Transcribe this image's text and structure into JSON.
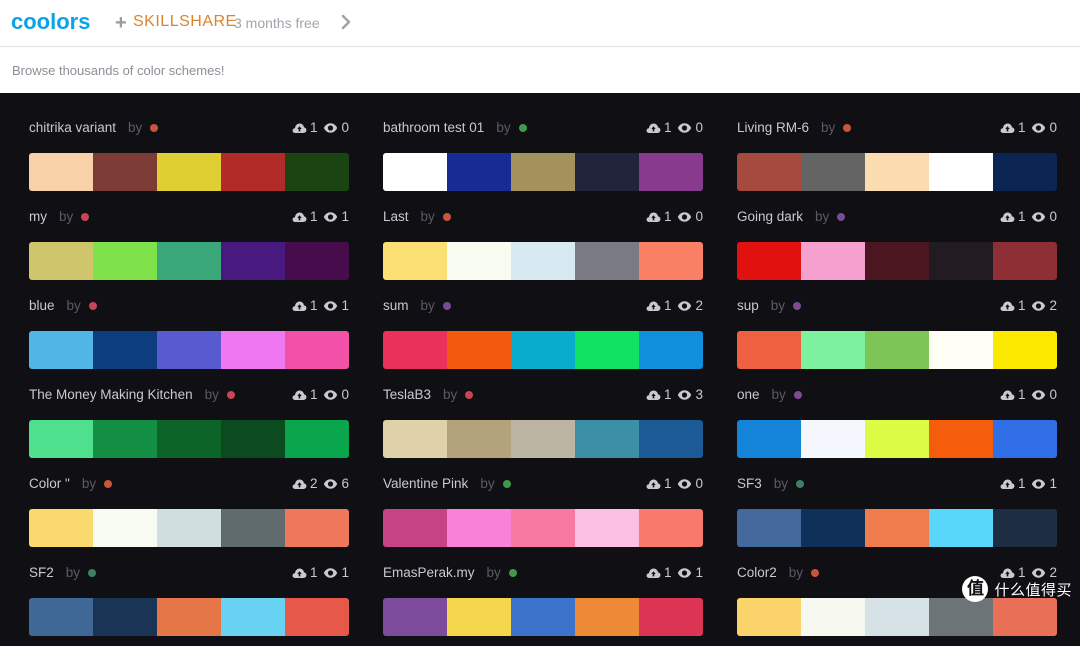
{
  "header": {
    "logo": "coolors",
    "plus": "+",
    "partner": "SKILLSHARE",
    "promo": "3 months free",
    "chevron_icon": "chevron-right-icon"
  },
  "subheader": {
    "text": "Browse thousands of color schemes!"
  },
  "palettes": [
    {
      "name": "chitrika variant",
      "by": "by",
      "dot": "#c9553a",
      "likes": "1",
      "views": "0",
      "colors": [
        "#f7d1a8",
        "#7c3b35",
        "#dfcf33",
        "#b12b28",
        "#1b4413"
      ]
    },
    {
      "name": "bathroom test 01",
      "by": "by",
      "dot": "#3f9a4a",
      "likes": "1",
      "views": "0",
      "colors": [
        "#ffffff",
        "#182a93",
        "#a3925b",
        "#21243a",
        "#883b8e"
      ]
    },
    {
      "name": "Living RM-6",
      "by": "by",
      "dot": "#c9553a",
      "likes": "1",
      "views": "0",
      "colors": [
        "#a54a3f",
        "#646464",
        "#fbdbb0",
        "#ffffff",
        "#0b2653"
      ]
    },
    {
      "name": "my",
      "by": "by",
      "dot": "#c94455",
      "likes": "1",
      "views": "1",
      "colors": [
        "#cfc56d",
        "#7fe24a",
        "#3aa77a",
        "#481a80",
        "#470c4b"
      ]
    },
    {
      "name": "Last",
      "by": "by",
      "dot": "#c9553a",
      "likes": "1",
      "views": "0",
      "colors": [
        "#fbdf73",
        "#f8fbef",
        "#d7e9f1",
        "#7a7a84",
        "#f98064"
      ]
    },
    {
      "name": "Going dark",
      "by": "by",
      "dot": "#7c4b92",
      "likes": "1",
      "views": "0",
      "colors": [
        "#e0110e",
        "#f5a0ce",
        "#4c1620",
        "#221b22",
        "#8e2f35"
      ]
    },
    {
      "name": "blue",
      "by": "by",
      "dot": "#c94455",
      "likes": "1",
      "views": "1",
      "colors": [
        "#51b6e5",
        "#0b3d7f",
        "#585bd0",
        "#ef77f0",
        "#f152a7"
      ]
    },
    {
      "name": "sum",
      "by": "by",
      "dot": "#7c4b92",
      "likes": "1",
      "views": "2",
      "colors": [
        "#e93159",
        "#f35a0f",
        "#0aaccd",
        "#10e262",
        "#0f8fdc"
      ]
    },
    {
      "name": "sup",
      "by": "by",
      "dot": "#7c4b92",
      "likes": "1",
      "views": "2",
      "colors": [
        "#ed6140",
        "#7df19f",
        "#7dc655",
        "#fffff6",
        "#fce900"
      ]
    },
    {
      "name": "The Money Making Kitchen",
      "by": "by",
      "dot": "#c94455",
      "likes": "1",
      "views": "0",
      "colors": [
        "#4fe08e",
        "#138f43",
        "#0d6429",
        "#0c4b1f",
        "#08a54c"
      ]
    },
    {
      "name": "TeslaB3",
      "by": "by",
      "dot": "#c94455",
      "likes": "1",
      "views": "3",
      "colors": [
        "#dfd2a9",
        "#b2a37d",
        "#bcb5a4",
        "#3b8fa7",
        "#1c5a96"
      ]
    },
    {
      "name": "one",
      "by": "by",
      "dot": "#7c4b92",
      "likes": "1",
      "views": "0",
      "colors": [
        "#1484d9",
        "#f4f7fd",
        "#dcfb44",
        "#f55c0c",
        "#306ee5"
      ]
    },
    {
      "name": "Color \"",
      "by": "by",
      "dot": "#c9553a",
      "likes": "2",
      "views": "6",
      "colors": [
        "#fada6e",
        "#f8fbf2",
        "#d1dee0",
        "#5f6b6c",
        "#ee775c"
      ]
    },
    {
      "name": "Valentine Pink",
      "by": "by",
      "dot": "#3f9a4a",
      "likes": "1",
      "views": "0",
      "colors": [
        "#c74484",
        "#f982d8",
        "#f87aa3",
        "#fbbfe2",
        "#f97a6b"
      ]
    },
    {
      "name": "SF3",
      "by": "by",
      "dot": "#3e7f63",
      "likes": "1",
      "views": "1",
      "colors": [
        "#43699c",
        "#0f3058",
        "#ef7c4a",
        "#58d7fb",
        "#1c2d44"
      ]
    },
    {
      "name": "SF2",
      "by": "by",
      "dot": "#3e7f63",
      "likes": "1",
      "views": "1",
      "colors": [
        "#3f6897",
        "#1a3455",
        "#e47648",
        "#67d2f1",
        "#e6584a"
      ]
    },
    {
      "name": "EmasPerak.my",
      "by": "by",
      "dot": "#3f9a4a",
      "likes": "1",
      "views": "1",
      "colors": [
        "#7c4b9c",
        "#f5d64c",
        "#3c74cc",
        "#ee8a37",
        "#dc3454"
      ]
    },
    {
      "name": "Color2",
      "by": "by",
      "dot": "#c9553a",
      "likes": "1",
      "views": "2",
      "colors": [
        "#fad36a",
        "#f6f8f0",
        "#d7e2e6",
        "#6d7477",
        "#ea6f57"
      ]
    }
  ],
  "watermark": {
    "badge": "值",
    "text": "什么值得买"
  }
}
